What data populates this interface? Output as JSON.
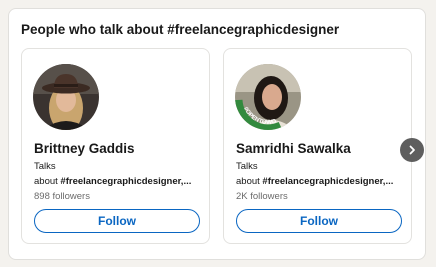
{
  "section": {
    "title": "People who talk about #freelancegraphicdesigner"
  },
  "people": [
    {
      "name": "Brittney Gaddis",
      "talks_label": "Talks",
      "about_prefix": "about ",
      "about_tags": "#freelancegraphicdesigner,...",
      "followers": "898 followers",
      "follow_label": "Follow"
    },
    {
      "name": "Samridhi Sawalka",
      "talks_label": "Talks",
      "about_prefix": "about ",
      "about_tags": "#freelancegraphicdesigner,...",
      "followers": "2K followers",
      "follow_label": "Follow",
      "avatar_frame_text": "#OPENTOWORK"
    }
  ],
  "navigation": {
    "next_icon": "chevron-right-icon"
  },
  "colors": {
    "accent": "#0a66c2",
    "open_to_work": "#338a3e"
  }
}
